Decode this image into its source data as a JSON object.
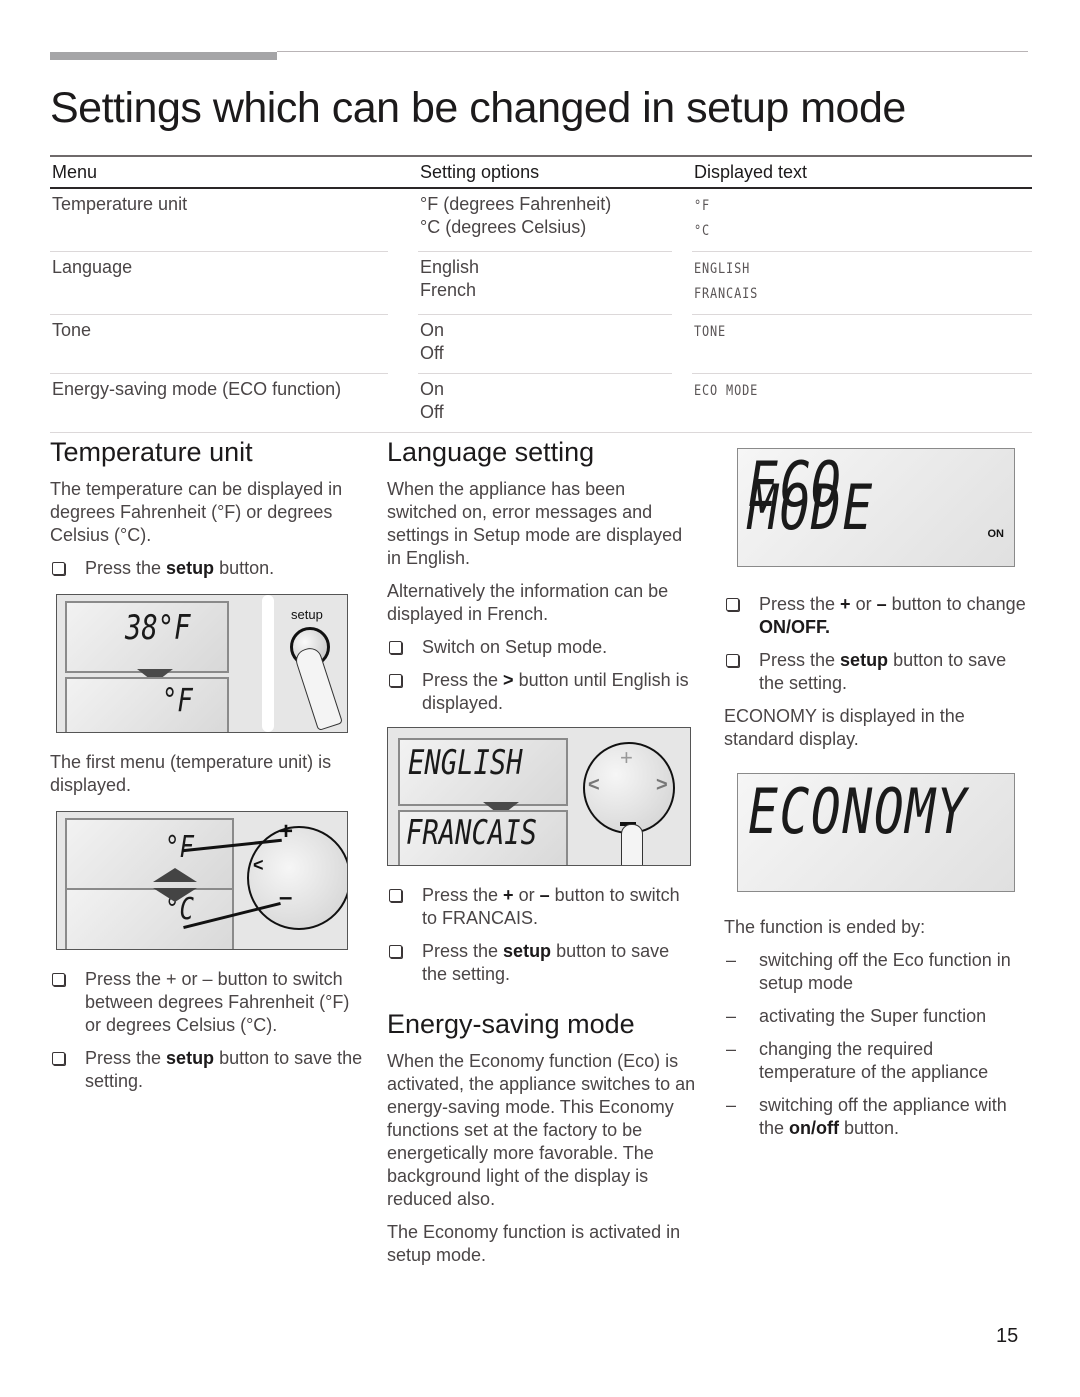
{
  "page": {
    "title": "Settings which can be changed in setup mode",
    "page_number": "15"
  },
  "table": {
    "headers": [
      "Menu",
      "Setting options",
      "Displayed text"
    ],
    "rows": [
      {
        "menu": "Temperature unit",
        "options": [
          "°F (degrees Fahrenheit)",
          "°C (degrees Celsius)"
        ],
        "displayed": [
          "°F",
          "°C"
        ]
      },
      {
        "menu": "Language",
        "options": [
          "English",
          "French"
        ],
        "displayed": [
          "ENGLISH",
          "FRANCAIS"
        ]
      },
      {
        "menu": "Tone",
        "options": [
          "On",
          "Off"
        ],
        "displayed": [
          "TONE",
          ""
        ]
      },
      {
        "menu": "Energy-saving mode (ECO function)",
        "options": [
          "On",
          "Off"
        ],
        "displayed": [
          "ECO MODE",
          ""
        ]
      }
    ]
  },
  "temperature_unit": {
    "heading": "Temperature unit",
    "intro": "The temperature can be displayed in degrees Fahrenheit (°F) or degrees Celsius (°C).",
    "step1_pre": "Press the ",
    "step1_bold": "setup",
    "step1_post": " button.",
    "illus1": {
      "display_top": "38°F",
      "display_bottom": "°F",
      "button_label": "setup"
    },
    "caption": "The first menu (temperature unit) is displayed.",
    "illus2": {
      "display_top": "°F",
      "display_bottom": "°C",
      "plus": "+",
      "minus": "–",
      "left": "<"
    },
    "step2": "Press the + or – button to switch between degrees Fahrenheit (°F) or degrees Celsius (°C).",
    "step3_pre": "Press the ",
    "step3_bold": "setup",
    "step3_post": " button to save the setting."
  },
  "language": {
    "heading": "Language setting",
    "intro1": "When the appliance has been switched on, error messages and settings in Setup mode are displayed in English.",
    "intro2": "Alternatively the information can be displayed in French.",
    "step1": "Switch on Setup mode.",
    "step2_pre": "Press the ",
    "step2_bold": ">",
    "step2_post": " button until English is displayed.",
    "illus": {
      "display_top": "ENGLISH",
      "display_bottom": "FRANCAIS",
      "plus": "+",
      "left": "<",
      "right": ">"
    },
    "step3_pre": "Press the ",
    "step3_plus": "+",
    "step3_mid": " or ",
    "step3_minus": "–",
    "step3_post": " button to switch to FRANCAIS.",
    "step4_pre": "Press the ",
    "step4_bold": "setup",
    "step4_post": " button to save the setting."
  },
  "energy": {
    "heading": "Energy-saving mode",
    "intro": "When the Economy function (Eco) is activated, the appliance switches to an energy-saving mode. This Economy functions set at the factory to be energetically more favorable. The background light of the display is reduced also.",
    "intro2": "The Economy function is activated in setup mode."
  },
  "eco": {
    "display1": "ECO MODE",
    "display1_badge": "ON",
    "step1_pre": "Press the ",
    "step1_plus": "+",
    "step1_mid": " or ",
    "step1_minus": "–",
    "step1_post": " button to change ",
    "step1_bold": "ON/OFF.",
    "step2_pre": "Press the ",
    "step2_bold": "setup",
    "step2_post": " button to save the setting.",
    "note": "ECONOMY is displayed in the standard display.",
    "display2": "ECONOMY",
    "ended_intro": "The function is ended by:",
    "ended_items": [
      "switching off the Eco function in setup mode",
      "activating the Super function",
      "changing the required temperature of the appliance"
    ],
    "ended_last_pre": "switching off the appliance with the ",
    "ended_last_bold": "on/off",
    "ended_last_post": " button.",
    "dash": "–"
  }
}
